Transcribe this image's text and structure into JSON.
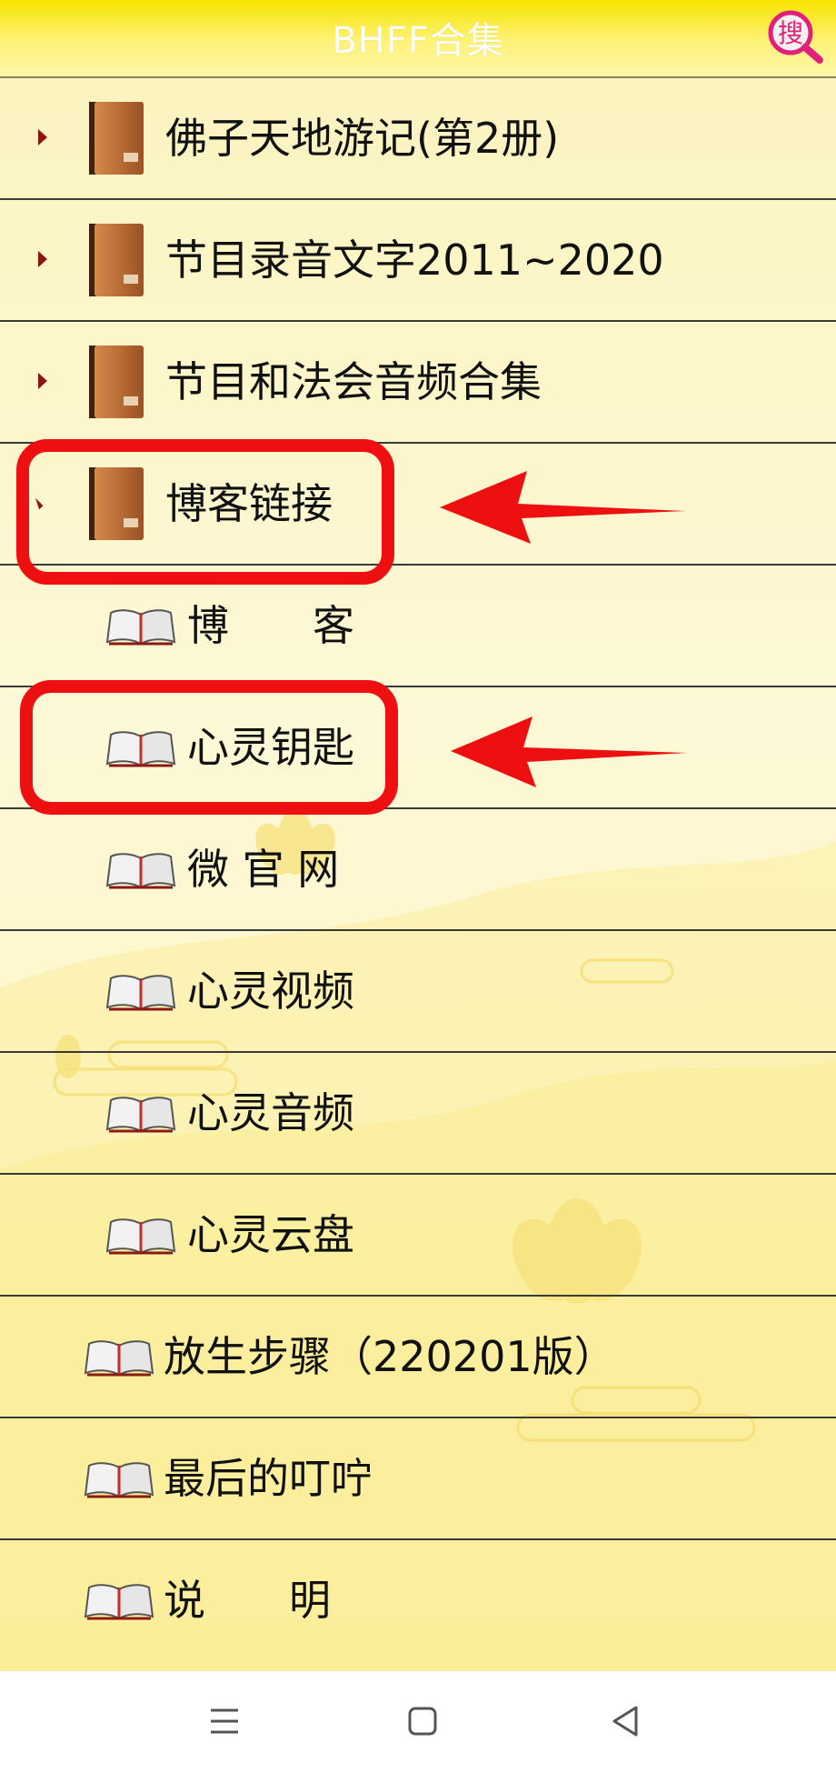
{
  "header": {
    "title": "BHFF合集",
    "search_label": "搜",
    "search_icon": "search-icon"
  },
  "list": {
    "folders": [
      {
        "label": "佛子天地游记(第2册)",
        "state": "collapsed"
      },
      {
        "label": "节目录音文字2011~2020",
        "state": "collapsed"
      },
      {
        "label": "节目和法会音频合集",
        "state": "collapsed"
      },
      {
        "label": "博客链接",
        "state": "expanded"
      }
    ],
    "children": [
      {
        "label": "博　　客"
      },
      {
        "label": "心灵钥匙"
      },
      {
        "label": "微 官 网"
      },
      {
        "label": "心灵视频"
      },
      {
        "label": "心灵音频"
      },
      {
        "label": "心灵云盘"
      }
    ],
    "items": [
      {
        "label": "放生步骤（220201版）"
      },
      {
        "label": "最后的叮咛"
      },
      {
        "label": "说　　明"
      }
    ]
  },
  "colors": {
    "header_yellow": "#f6e400",
    "list_bg": "#fdf8d0",
    "expander": "#8e1414",
    "folder_brown": "#b86a2e",
    "annotation_red": "#ee1010"
  },
  "navbar": {
    "icons": [
      "menu-icon",
      "home-square-icon",
      "back-triangle-icon"
    ]
  }
}
